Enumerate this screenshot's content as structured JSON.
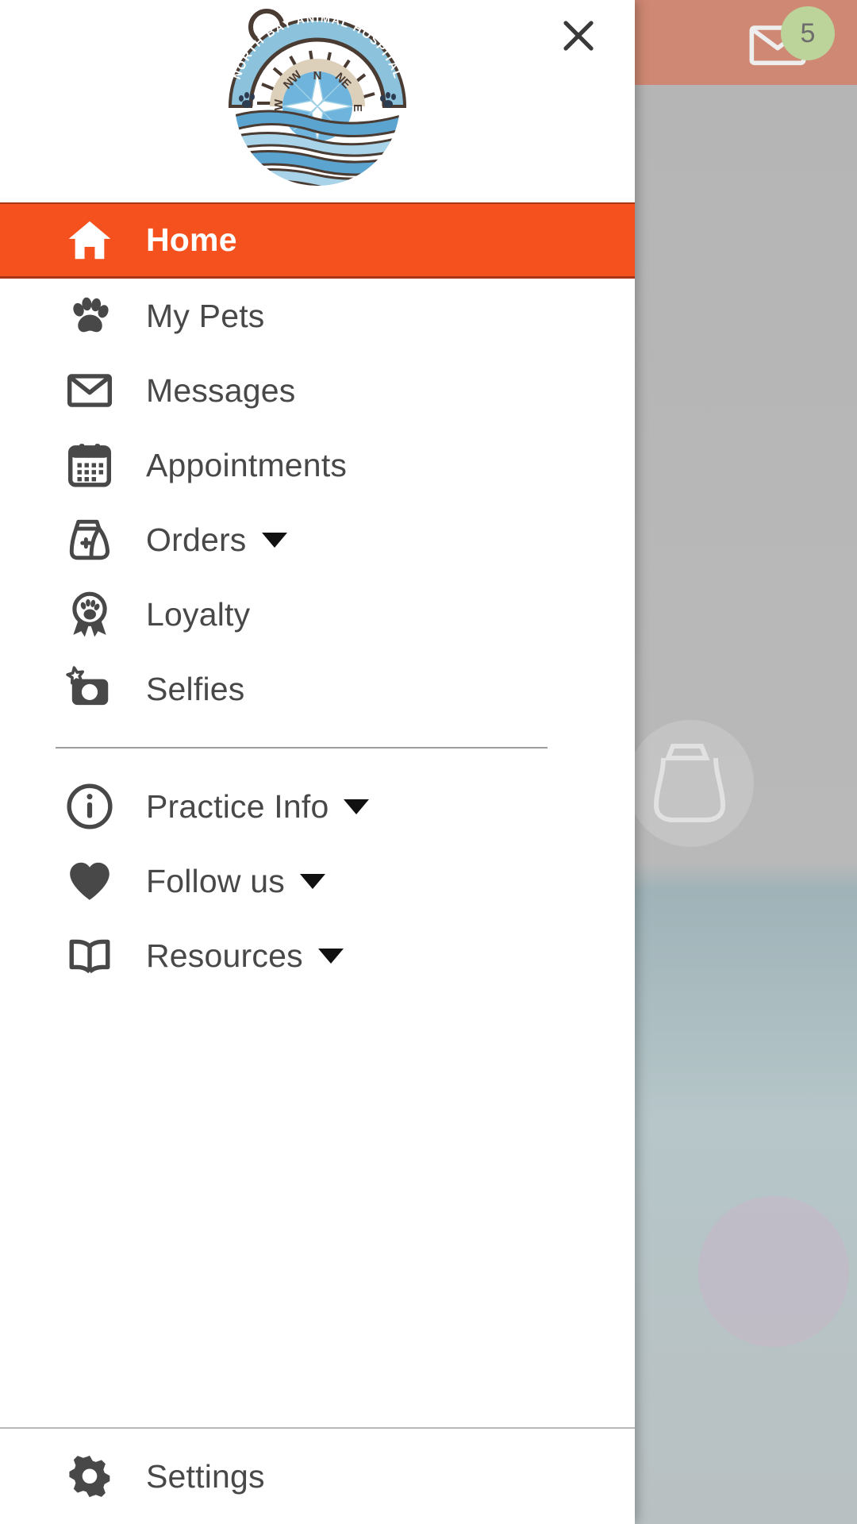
{
  "background_app": {
    "header_color": "#cf8873",
    "mail_icon": "envelope-icon",
    "badge_count": "5",
    "badge_color": "#bcd39a"
  },
  "drawer": {
    "logo": {
      "icon": "compass-logo",
      "text": "NORTH BAY ANIMAL HOSPITAL",
      "compass_labels": [
        "W",
        "NW",
        "N",
        "NE",
        "E"
      ],
      "colors": {
        "ring": "#8cc2dc",
        "outline": "#4a3b33",
        "sand": "#ddd0bb",
        "water": "#5ba4d0",
        "water_light": "#a9d3e8"
      }
    },
    "close_button": {
      "icon": "close-icon",
      "label": "Close"
    },
    "accent_color": "#F4511E",
    "text_color": "#484848",
    "items": [
      {
        "id": "home",
        "label": "Home",
        "icon": "home-icon",
        "active": true,
        "expandable": false
      },
      {
        "id": "my-pets",
        "label": "My Pets",
        "icon": "paw-icon",
        "active": false,
        "expandable": false
      },
      {
        "id": "messages",
        "label": "Messages",
        "icon": "envelope-icon",
        "active": false,
        "expandable": false
      },
      {
        "id": "appointments",
        "label": "Appointments",
        "icon": "calendar-icon",
        "active": false,
        "expandable": false
      },
      {
        "id": "orders",
        "label": "Orders",
        "icon": "food-bag-icon",
        "active": false,
        "expandable": true
      },
      {
        "id": "loyalty",
        "label": "Loyalty",
        "icon": "award-paw-icon",
        "active": false,
        "expandable": false
      },
      {
        "id": "selfies",
        "label": "Selfies",
        "icon": "camera-star-icon",
        "active": false,
        "expandable": false
      }
    ],
    "secondary_items": [
      {
        "id": "practice-info",
        "label": "Practice Info",
        "icon": "info-circle-icon",
        "expandable": true
      },
      {
        "id": "follow-us",
        "label": "Follow us",
        "icon": "heart-icon",
        "expandable": true
      },
      {
        "id": "resources",
        "label": "Resources",
        "icon": "open-book-icon",
        "expandable": true
      }
    ],
    "footer_items": [
      {
        "id": "settings",
        "label": "Settings",
        "icon": "gear-icon",
        "expandable": false
      }
    ]
  }
}
